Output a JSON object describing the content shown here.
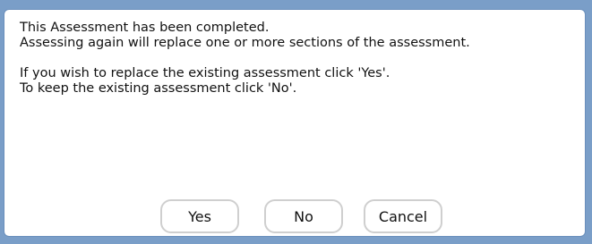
{
  "dialog": {
    "lines": [
      "This Assessment has been completed.",
      "Assessing again will replace one or more sections of the assessment.",
      "If you wish to replace the existing assessment click 'Yes'.",
      "To keep the existing assessment click 'No'."
    ],
    "buttons": {
      "yes": "Yes",
      "no": "No",
      "cancel": "Cancel"
    }
  }
}
